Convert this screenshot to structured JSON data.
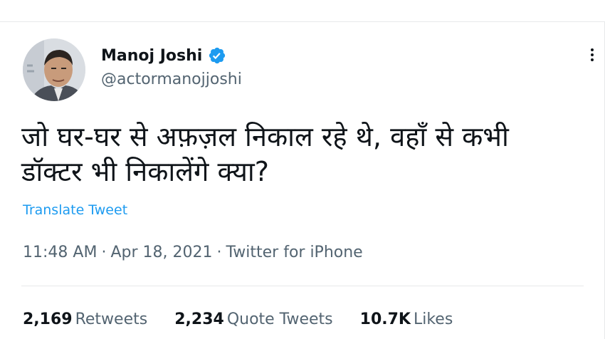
{
  "author": {
    "name": "Manoj Joshi",
    "handle": "@actormanojjoshi",
    "verified": true
  },
  "tweet": {
    "text_line1": "जो घर-घर से अफ़ज़ल निकाल रहे थे, वहाँ से कभी",
    "text_line2": "डॉक्टर भी निकालेंगे क्या?",
    "translate_label": "Translate Tweet",
    "time": "11:48 AM",
    "date": "Apr 18, 2021",
    "source": "Twitter for iPhone",
    "separator": "·"
  },
  "stats": {
    "retweets_count": "2,169",
    "retweets_label": "Retweets",
    "quote_count": "2,234",
    "quote_label": "Quote Tweets",
    "likes_count": "10.7K",
    "likes_label": "Likes"
  },
  "colors": {
    "accent": "#1d9bf0",
    "text": "#0f1419",
    "secondary": "#536471",
    "border": "#e7e9ea"
  },
  "icons": {
    "verified": "verified-badge-icon",
    "more": "more-options-icon"
  }
}
